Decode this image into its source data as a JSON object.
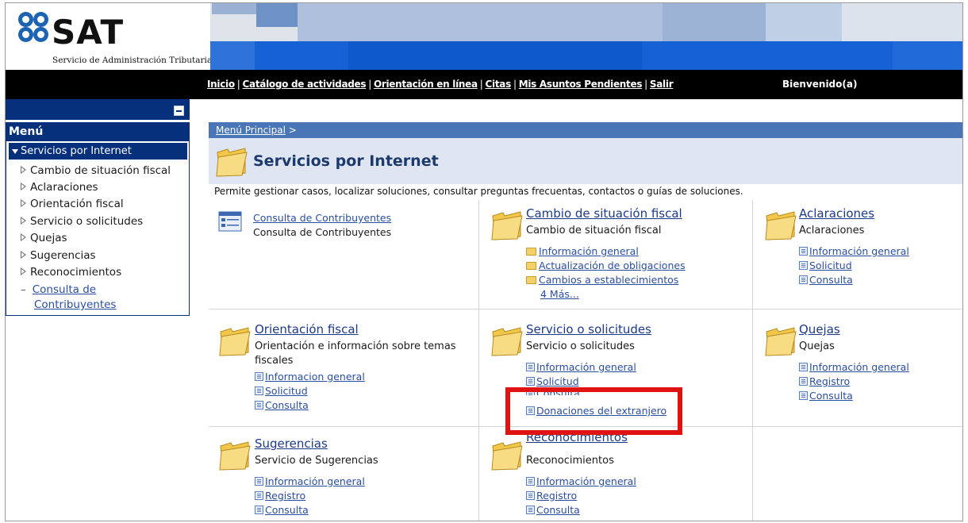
{
  "brand": {
    "name": "SAT",
    "subtitle": "Servicio de Administración Tributaria"
  },
  "topnav": {
    "links": [
      "Inicio",
      "Catálogo de actividades",
      "Orientación en línea",
      "Citas",
      "Mis Asuntos Pendientes",
      "Salir"
    ],
    "welcome": "Bienvenido(a)"
  },
  "sidebar": {
    "header": "Menú",
    "selected": "Servicios por Internet",
    "items": [
      "Cambio de situación fiscal",
      "Aclaraciones",
      "Orientación fiscal",
      "Servicio o solicitudes",
      "Quejas",
      "Sugerencias",
      "Reconocimientos"
    ],
    "link_line1": "Consulta de",
    "link_line2": "Contribuyentes"
  },
  "breadcrumb": {
    "link": "Menú Principal",
    "sep": ">"
  },
  "page": {
    "title": "Servicios por Internet",
    "description": "Permite gestionar casos, localizar soluciones, consultar preguntas frecuentas, contactos o guías de soluciones."
  },
  "cards": {
    "consulta": {
      "title": "Consulta de Contribuyentes",
      "desc": "Consulta de Contribuyentes"
    },
    "cambio": {
      "title": "Cambio de situación fiscal",
      "desc": "Cambio de situación fiscal",
      "links": [
        "Información general",
        "Actualización de obligaciones",
        "Cambios a establecimientos"
      ],
      "more": "4 Más..."
    },
    "aclaraciones": {
      "title": "Aclaraciones",
      "desc": "Aclaraciones",
      "links": [
        "Información general",
        "Solicitud",
        "Consulta"
      ]
    },
    "orientacion": {
      "title": "Orientación fiscal",
      "desc_line1": "Orientación e información sobre temas",
      "desc_line2": "fiscales",
      "links": [
        "Informacion general",
        "Solicitud",
        "Consulta"
      ]
    },
    "servicio": {
      "title": "Servicio o solicitudes",
      "desc": "Servicio o solicitudes",
      "links": [
        "Información general",
        "Solicitud",
        "Consulta",
        "Donaciones del extranjero"
      ]
    },
    "quejas": {
      "title": "Quejas",
      "desc": "Quejas",
      "links": [
        "Información general",
        "Registro",
        "Consulta"
      ]
    },
    "sugerencias": {
      "title": "Sugerencias",
      "desc": "Servicio de Sugerencias",
      "links": [
        "Información general",
        "Registro",
        "Consulta"
      ]
    },
    "reconocimientos": {
      "title": "Reconocimientos",
      "desc": "Reconocimientos",
      "links": [
        "Información general",
        "Registro",
        "Consulta"
      ]
    }
  },
  "colors": {
    "nav_dark": "#06307b",
    "link": "#2a4ea0",
    "highlight": "#e11212"
  }
}
